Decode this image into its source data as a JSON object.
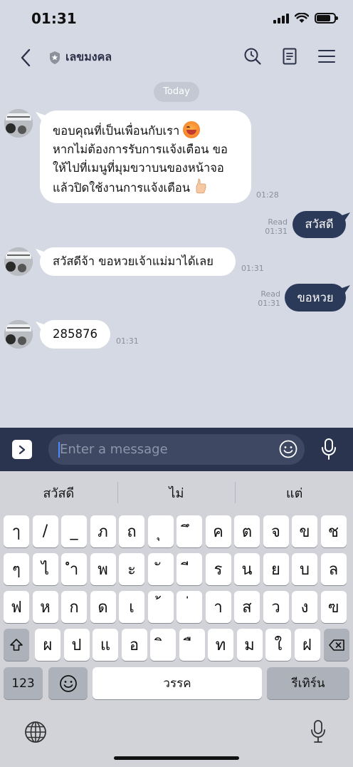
{
  "status": {
    "time": "01:31"
  },
  "header": {
    "title": "เลขมงคล"
  },
  "date_chip": "Today",
  "messages": [
    {
      "dir": "in",
      "lines": [
        "ขอบคุณที่เป็นเพื่อนกับเรา",
        "หากไม่ต้องการรับการแจ้งเตือน ขอ",
        "ให้ไปที่เมนูที่มุมขวาบนของหน้าจอ",
        "แล้วปิดใช้งานการแจ้งเตือน"
      ],
      "time": "01:28"
    },
    {
      "dir": "out",
      "text": "สวัสดี",
      "read": "Read",
      "time": "01:31"
    },
    {
      "dir": "in",
      "text": "สวัสดีจ้า ขอหวยเจ้าแม่มาได้เลย",
      "time": "01:31"
    },
    {
      "dir": "out",
      "text": "ขอหวย",
      "read": "Read",
      "time": "01:31"
    },
    {
      "dir": "in",
      "text": "285876",
      "time": "01:31"
    }
  ],
  "input": {
    "placeholder": "Enter a message"
  },
  "keyboard": {
    "suggestions": [
      "สวัสดี",
      "ไม่",
      "แต่"
    ],
    "row1": [
      "ๅ",
      "/",
      "_",
      "ภ",
      "ถ",
      "ุ",
      "ึ",
      "ค",
      "ต",
      "จ",
      "ข",
      "ช"
    ],
    "row2": [
      "ๆ",
      "ไ",
      "ำ",
      "พ",
      "ะ",
      "ั",
      "ี",
      "ร",
      "น",
      "ย",
      "บ",
      "ล"
    ],
    "row3": [
      "ฟ",
      "ห",
      "ก",
      "ด",
      "เ",
      "้",
      "่",
      "า",
      "ส",
      "ว",
      "ง",
      "ฃ"
    ],
    "row4": [
      "ผ",
      "ป",
      "แ",
      "อ",
      "ิ",
      "ื",
      "ท",
      "ม",
      "ใ",
      "ฝ"
    ],
    "numbers_key": "123",
    "space_key": "วรรค",
    "return_key": "รีเทิร์น"
  }
}
